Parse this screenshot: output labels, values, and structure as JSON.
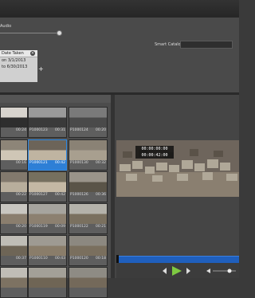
{
  "filter": {
    "audio_label": "Audio",
    "smart_catalog_label": "Smart Catalog",
    "smart_catalog_value": "",
    "date_filter": {
      "header": "Date Taken",
      "from": "on 3/1/2013",
      "to": "to 6/30/2013"
    },
    "add_label": "+"
  },
  "clips": [
    {
      "name": "",
      "duration": "00:24"
    },
    {
      "name": "P1000123",
      "duration": "00:31"
    },
    {
      "name": "P1000124",
      "duration": "00:20"
    },
    {
      "name": "",
      "duration": "00:16"
    },
    {
      "name": "P1000121",
      "duration": "00:42"
    },
    {
      "name": "P1000130",
      "duration": "00:32"
    },
    {
      "name": "",
      "duration": "00:22"
    },
    {
      "name": "P1000127",
      "duration": "00:42"
    },
    {
      "name": "P1000126",
      "duration": "00:36"
    },
    {
      "name": "",
      "duration": "00:20"
    },
    {
      "name": "P1000119",
      "duration": "00:09"
    },
    {
      "name": "P1000122",
      "duration": "00:21"
    },
    {
      "name": "",
      "duration": "00:37"
    },
    {
      "name": "P1000110",
      "duration": "00:43"
    },
    {
      "name": "P1000120",
      "duration": "00:18"
    },
    {
      "name": "",
      "duration": ""
    },
    {
      "name": "",
      "duration": ""
    },
    {
      "name": "",
      "duration": ""
    }
  ],
  "viewer": {
    "timecode_top": "00:00:00:00",
    "timecode_bottom": "00:00:42:00"
  },
  "colors": {
    "accent": "#2e7fd6",
    "play": "#7ec942"
  }
}
